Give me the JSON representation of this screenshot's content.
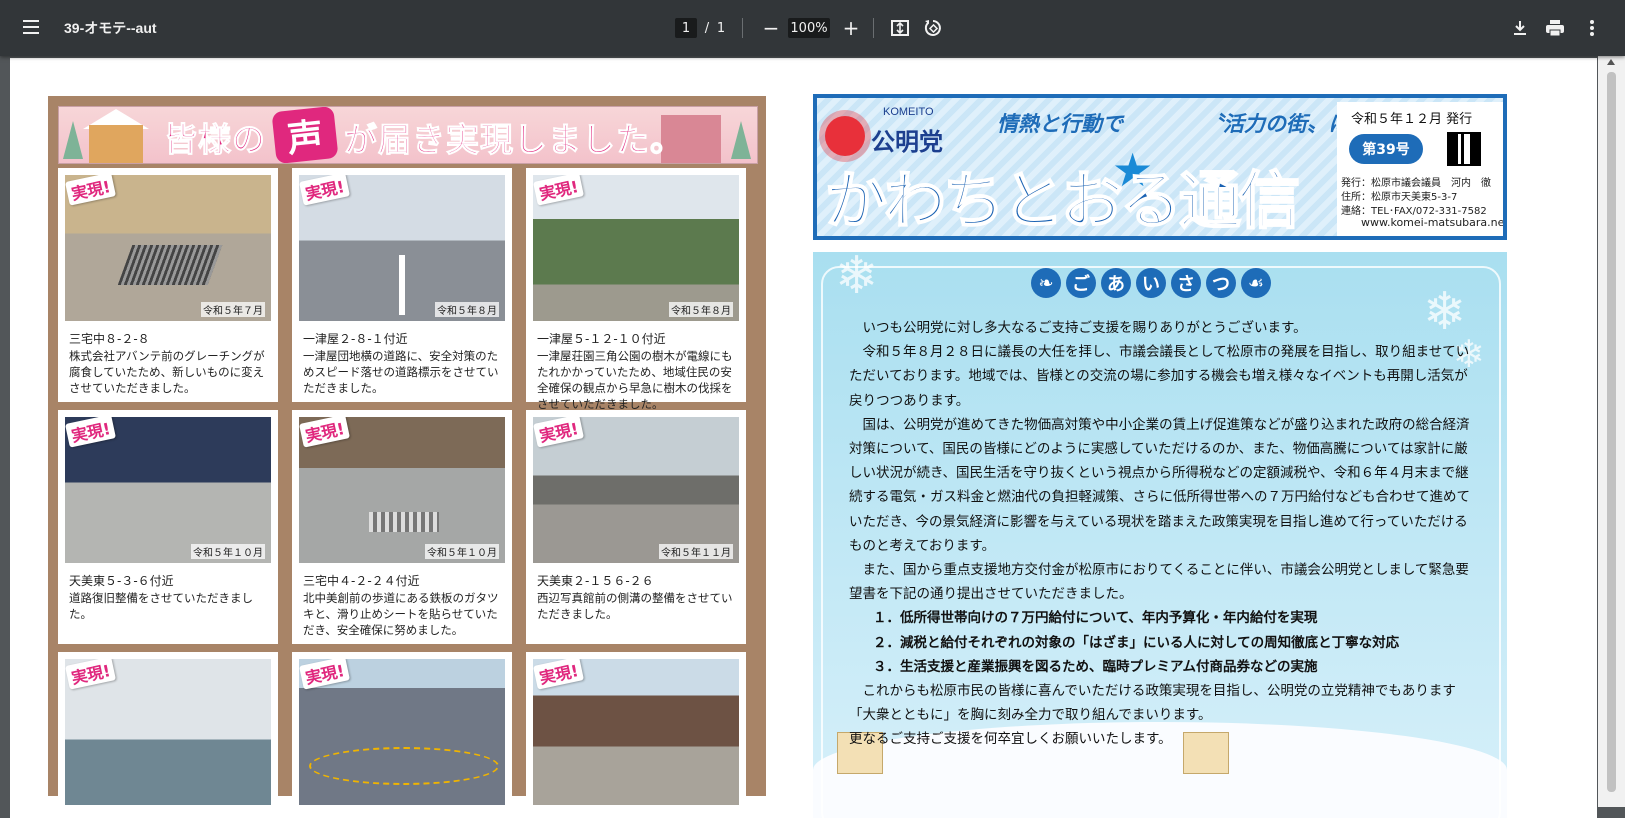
{
  "toolbar": {
    "title": "39-オモテ--aut",
    "page_current": "1",
    "page_separator": "/",
    "page_total": "1",
    "zoom_minus": "−",
    "zoom_value": "100%",
    "zoom_plus": "+"
  },
  "icons": [
    "menu-icon",
    "zoom-out-icon",
    "zoom-in-icon",
    "fit-page-icon",
    "rotate-icon",
    "download-icon",
    "print-icon",
    "more-vert-icon"
  ],
  "left_banner": {
    "text_before": "皆様の",
    "voice": "声",
    "text_after": "が届き実現しました。"
  },
  "cards": [
    {
      "badge": "実現!",
      "date": "令和５年７月",
      "addr": "三宅中８-２-８",
      "desc": "株式会社アバンテ前のグレーチングが腐食していたため、新しいものに変えさせていただきました。"
    },
    {
      "badge": "実現!",
      "date": "令和５年８月",
      "addr": "一津屋２-８-１付近",
      "desc": "一津屋団地横の道路に、安全対策のためスピード落せの道路標示をさせていただきました。"
    },
    {
      "badge": "実現!",
      "date": "令和５年８月",
      "addr": "一津屋５-１２-１０付近",
      "desc": "一津屋荘園三角公園の樹木が電線にもたれかかっていたため、地域住民の安全確保の観点から早急に樹木の伐採をさせていただきました。"
    },
    {
      "badge": "実現!",
      "date": "令和５年１０月",
      "addr": "天美東５-３-６付近",
      "desc": "道路復旧整備をさせていただきました。"
    },
    {
      "badge": "実現!",
      "date": "令和５年１０月",
      "addr": "三宅中４-２-２４付近",
      "desc": "北中美創前の歩道にある鉄板のガタツキと、滑り止めシートを貼らせていただき、安全確保に努めました。"
    },
    {
      "badge": "実現!",
      "date": "令和５年１１月",
      "addr": "天美東２-１５６-２６",
      "desc": "西辺写真館前の側溝の整備をさせていただきました。"
    },
    {
      "badge": "実現!",
      "date": "",
      "addr": "",
      "desc": ""
    },
    {
      "badge": "実現!",
      "date": "",
      "addr": "",
      "desc": ""
    },
    {
      "badge": "実現!",
      "date": "",
      "addr": "",
      "desc": ""
    }
  ],
  "masthead": {
    "komeito": "KOMEITO",
    "party": "公明党",
    "slogan1": "情熱と行動で",
    "slogan2": "〝活力の街〟に!",
    "title": "かわちとおる通信",
    "issue_date": "令和５年１２月 発行",
    "issue_number": "第39号",
    "publisher": "発行：松原市議会議員　河内　徹",
    "address": "住所：松原市天美東5-3-7",
    "contact": "連絡：TEL･FAX/072-331-7582",
    "url": "www.komei-matsubara.net/"
  },
  "greeting": {
    "heading": [
      "❧",
      "ご",
      "あ",
      "い",
      "さ",
      "つ",
      "☙"
    ],
    "p1": "いつも公明党に対し多大なるご支持ご支援を賜りありがとうございます。",
    "p2": "令和５年８月２８日に議長の大任を拝し、市議会議長として松原市の発展を目指し、取り組ませていただいております。地域では、皆様との交流の場に参加する機会も増え様々なイベントも再開し活気が戻りつつあります。",
    "p3": "国は、公明党が進めてきた物価高対策や中小企業の賃上げ促進策などが盛り込まれた政府の総合経済対策について、国民の皆様にどのように実感していただけるのか、また、物価高騰については家計に厳しい状況が続き、国民生活を守り抜くという視点から所得税などの定額減税や、令和６年４月末まで継続する電気・ガス料金と燃油代の負担軽減策、さらに低所得世帯への７万円給付なども合わせて進めていただき、今の景気経済に影響を与えている現状を踏まえた政策実現を目指し進めて行っていただけるものと考えております。",
    "p4": "また、国から重点支援地方交付金が松原市におりてくることに伴い、市議会公明党としまして緊急要望書を下記の通り提出させていただきました。",
    "list": [
      "１．低所得世帯向けの７万円給付について、年内予算化・年内給付を実現",
      "２．減税と給付それぞれの対象の「はざま」にいる人に対しての周知徹底と丁寧な対応",
      "３．生活支援と産業振興を図るため、臨時プレミアム付商品券などの実施"
    ],
    "p5": "これからも松原市民の皆様に喜んでいただける政策実現を目指し、公明党の立党精神でもあります「大衆とともに」を胸に刻み全力で取り組んでまいります。",
    "p6": "更なるご支持ご支援を何卒宜しくお願いいたします。"
  },
  "colors": {
    "toolbar": "#323639",
    "viewer_bg": "#525659",
    "accent_pink": "#e0287e",
    "accent_blue": "#1e6cb8"
  }
}
